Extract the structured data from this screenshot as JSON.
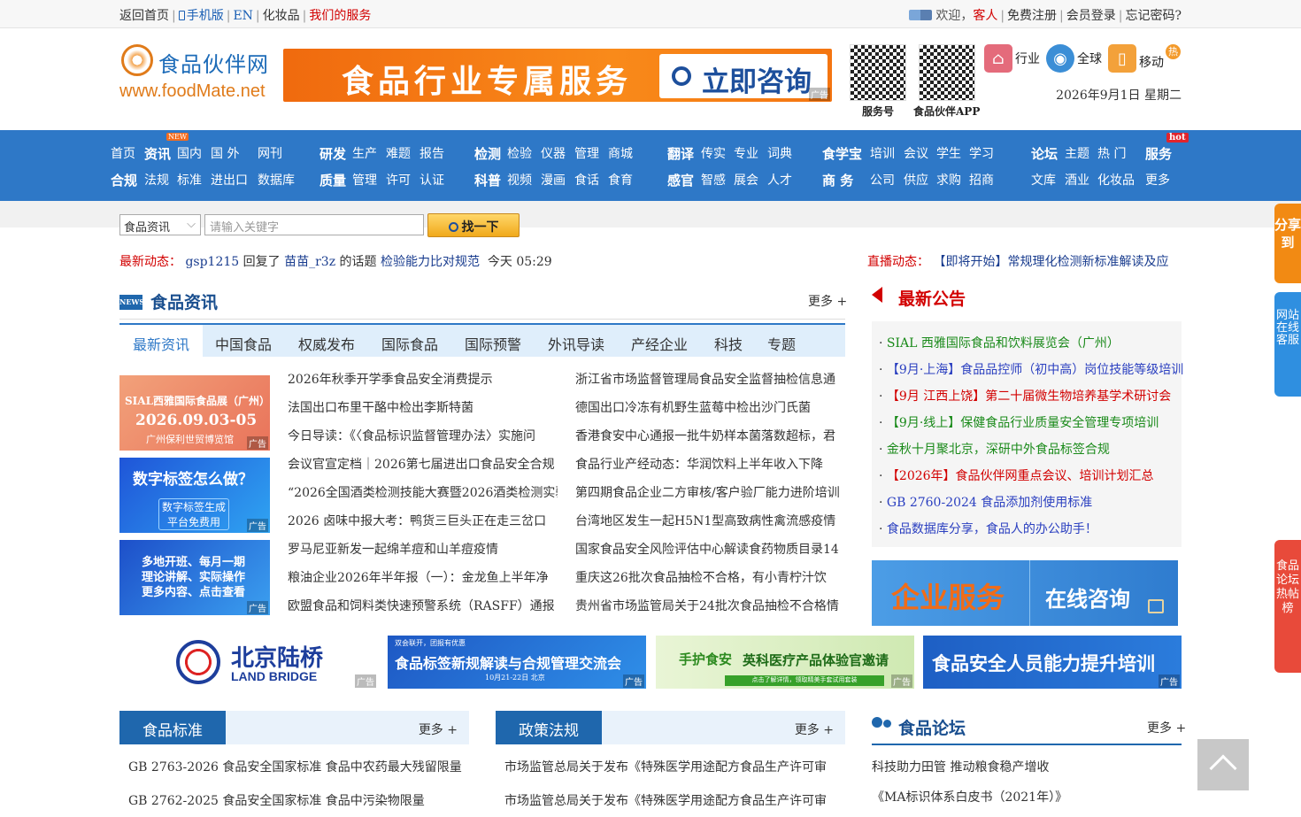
{
  "topbar": {
    "home": "返回首页",
    "mobile": "手机版",
    "en": "EN",
    "cosmetics": "化妆品",
    "service": "我们的服务",
    "welcome": "欢迎，",
    "guest": "客人",
    "register": "免费注册",
    "login": "会员登录",
    "forgot": "忘记密码?"
  },
  "header": {
    "logo_name": "食品伙伴网",
    "logo_url": "www.foodMate.net",
    "banner_text": "食品行业专属服务",
    "banner_button": "立即咨询",
    "ad_tag": "广告",
    "qr1_label": "服务号",
    "qr2_label": "食品伙伴APP",
    "links": [
      "行业",
      "全球",
      "移动"
    ],
    "hot_badge": "热",
    "date": "2026年9月1日 星期二"
  },
  "nav": {
    "new_badge": "NEW",
    "hot_badge": "hot",
    "row1": [
      {
        "label": "首页",
        "bold": false
      },
      {
        "label": "资讯",
        "bold": true
      },
      {
        "label": "国内",
        "bold": false
      },
      {
        "label": "国 外",
        "bold": false
      },
      {
        "label": "网刊",
        "bold": false
      },
      {
        "label": "研发",
        "bold": true
      },
      {
        "label": "生产",
        "bold": false
      },
      {
        "label": "难题",
        "bold": false
      },
      {
        "label": "报告",
        "bold": false
      },
      {
        "label": "检测",
        "bold": true
      },
      {
        "label": "检验",
        "bold": false
      },
      {
        "label": "仪器",
        "bold": false
      },
      {
        "label": "管理",
        "bold": false
      },
      {
        "label": "商城",
        "bold": false
      },
      {
        "label": "翻译",
        "bold": true
      },
      {
        "label": "传实",
        "bold": false
      },
      {
        "label": "专业",
        "bold": false
      },
      {
        "label": "词典",
        "bold": false
      },
      {
        "label": "食学宝",
        "bold": true
      },
      {
        "label": "培训",
        "bold": false
      },
      {
        "label": "会议",
        "bold": false
      },
      {
        "label": "学生",
        "bold": false
      },
      {
        "label": "学习",
        "bold": false
      },
      {
        "label": "论坛",
        "bold": true
      },
      {
        "label": "主题",
        "bold": false
      },
      {
        "label": "热 门",
        "bold": false
      },
      {
        "label": "服务",
        "bold": true
      }
    ],
    "row2": [
      {
        "label": "合规",
        "bold": true
      },
      {
        "label": "法规",
        "bold": false
      },
      {
        "label": "标准",
        "bold": false
      },
      {
        "label": "进出口",
        "bold": false
      },
      {
        "label": "数据库",
        "bold": false
      },
      {
        "label": "质量",
        "bold": true
      },
      {
        "label": "管理",
        "bold": false
      },
      {
        "label": "许可",
        "bold": false
      },
      {
        "label": "认证",
        "bold": false
      },
      {
        "label": "科普",
        "bold": true
      },
      {
        "label": "视频",
        "bold": false
      },
      {
        "label": "漫画",
        "bold": false
      },
      {
        "label": "食话",
        "bold": false
      },
      {
        "label": "食育",
        "bold": false
      },
      {
        "label": "感官",
        "bold": true
      },
      {
        "label": "智感",
        "bold": false
      },
      {
        "label": "展会",
        "bold": false
      },
      {
        "label": "人才",
        "bold": false
      },
      {
        "label": "商 务",
        "bold": true
      },
      {
        "label": "公司",
        "bold": false
      },
      {
        "label": "供应",
        "bold": false
      },
      {
        "label": "求购",
        "bold": false
      },
      {
        "label": "招商",
        "bold": false
      },
      {
        "label": "文库",
        "bold": false
      },
      {
        "label": "酒业",
        "bold": false
      },
      {
        "label": "化妆品",
        "bold": false
      },
      {
        "label": "更多",
        "bold": false
      }
    ]
  },
  "search": {
    "category": "食品资讯",
    "placeholder": "请输入关键字",
    "button": "找一下"
  },
  "dynamic": {
    "label": "最新动态：",
    "user": "gsp1215",
    "action": "回复了",
    "target_user": "苗苗_r3z",
    "topic_prefix": "的话题",
    "topic": "检验能力比对规范",
    "time": "今天 05:29"
  },
  "live": {
    "label": "直播动态：",
    "text": "【即将开始】常规理化检测新标准解读及应"
  },
  "news": {
    "title": "食品资讯",
    "more": "更多 +",
    "tabs": [
      "最新资讯",
      "中国食品",
      "权威发布",
      "国际食品",
      "国际预警",
      "外讯导读",
      "产经企业",
      "科技",
      "专题"
    ],
    "thumbs": [
      {
        "line1": "SIAL西雅国际食品展（广州）",
        "line2": "2026.09.03-05",
        "line3": "广州保利世贸博览馆"
      },
      {
        "line1": "数字标签怎么做？",
        "line2": "数字标签生成 平台免费用"
      },
      {
        "line1": "多地开班、每月一期",
        "line2": "理论讲解、实际操作",
        "line3": "更多内容、点击查看"
      }
    ],
    "col1": [
      "2026年秋季开学季食品安全消费提示",
      "法国出口布里干酪中检出李斯特菌",
      "今日导读：《〈食品标识监督管理办法〉实施问",
      "会议官宣定档｜2026第七届进出口食品安全合规",
      "“2026全国酒类检测技能大赛暨2026酒类检测实验",
      "2026 卤味中报大考：鸭货三巨头正在走三岔口",
      "罗马尼亚新发一起绵羊痘和山羊痘疫情",
      "粮油企业2026年半年报（一）：金龙鱼上半年净",
      "欧盟食品和饲料类快速预警系统（RASFF）通报"
    ],
    "col2": [
      "浙江省市场监督管理局食品安全监督抽检信息通",
      "德国出口冷冻有机野生蓝莓中检出沙门氏菌",
      "香港食安中心通报一批牛奶样本菌落数超标，君",
      "食品行业产经动态：华润饮料上半年收入下降",
      "第四期食品企业二方审核/客户验厂能力进阶培训",
      "台湾地区发生一起H5N1型高致病性禽流感疫情",
      "国家食品安全风险评估中心解读食药物质目录14",
      "重庆这26批次食品抽检不合格，有小青柠汁饮",
      "贵州省市场监管局关于24批次食品抽检不合格情"
    ]
  },
  "notice": {
    "title": "最新公告",
    "items": [
      {
        "text": "SIAL 西雅国际食品和饮料展览会（广州）",
        "color": "#1a8a1a"
      },
      {
        "text": "【9月·上海】食品品控师（初中高）岗位技能等级培训",
        "color": "#2a3fc0"
      },
      {
        "text": "【9月 江西上饶】第二十届微生物培养基学术研讨会",
        "color": "#d20000"
      },
      {
        "text": "【9月·线上】保健食品行业质量安全管理专项培训",
        "color": "#1a8a1a"
      },
      {
        "text": "金秋十月聚北京，深研中外食品标签合规",
        "color": "#1a8a1a"
      },
      {
        "text": "【2026年】食品伙伴网重点会议、培训计划汇总",
        "color": "#d20000"
      },
      {
        "text": "GB 2760-2024 食品添加剂使用标准",
        "color": "#2a3fc0"
      },
      {
        "text": "食品数据库分享，食品人的办公助手！",
        "color": "#2a3fc0"
      }
    ],
    "banner_left": "企业服务",
    "banner_right": "在线咨询"
  },
  "ads": [
    {
      "title": "北京陆桥",
      "sub": "LAND BRIDGE"
    },
    {
      "top": "双会联开，团报有优惠",
      "title": "食品标签新规解读与合规管理交流会",
      "sub": "10月21-22日 北京"
    },
    {
      "title": "英科医疗产品体验官邀请",
      "brand": "手护食安",
      "sub": "点击了解详情，领取精美手套试用套装"
    },
    {
      "title": "食品安全人员能力提升培训"
    }
  ],
  "bottom": {
    "standards": {
      "title": "食品标准",
      "more": "更多 +",
      "items": [
        "GB 2763-2026 食品安全国家标准 食品中农药最大残留限量",
        "GB 2762-2025 食品安全国家标准 食品中污染物限量"
      ]
    },
    "policy": {
      "title": "政策法规",
      "more": "更多 +",
      "items": [
        "市场监管总局关于发布《特殊医学用途配方食品生产许可审",
        "市场监管总局关于发布《特殊医学用途配方食品生产许可审"
      ]
    },
    "forum": {
      "title": "食品论坛",
      "more": "更多 +",
      "items": [
        "科技助力田管 推动粮食稳产增收",
        "《MA标识体系白皮书（2021年）》"
      ]
    }
  },
  "side": {
    "share": "分享到",
    "kefu": "网站在线客服",
    "hot": "食品论坛热帖榜"
  }
}
